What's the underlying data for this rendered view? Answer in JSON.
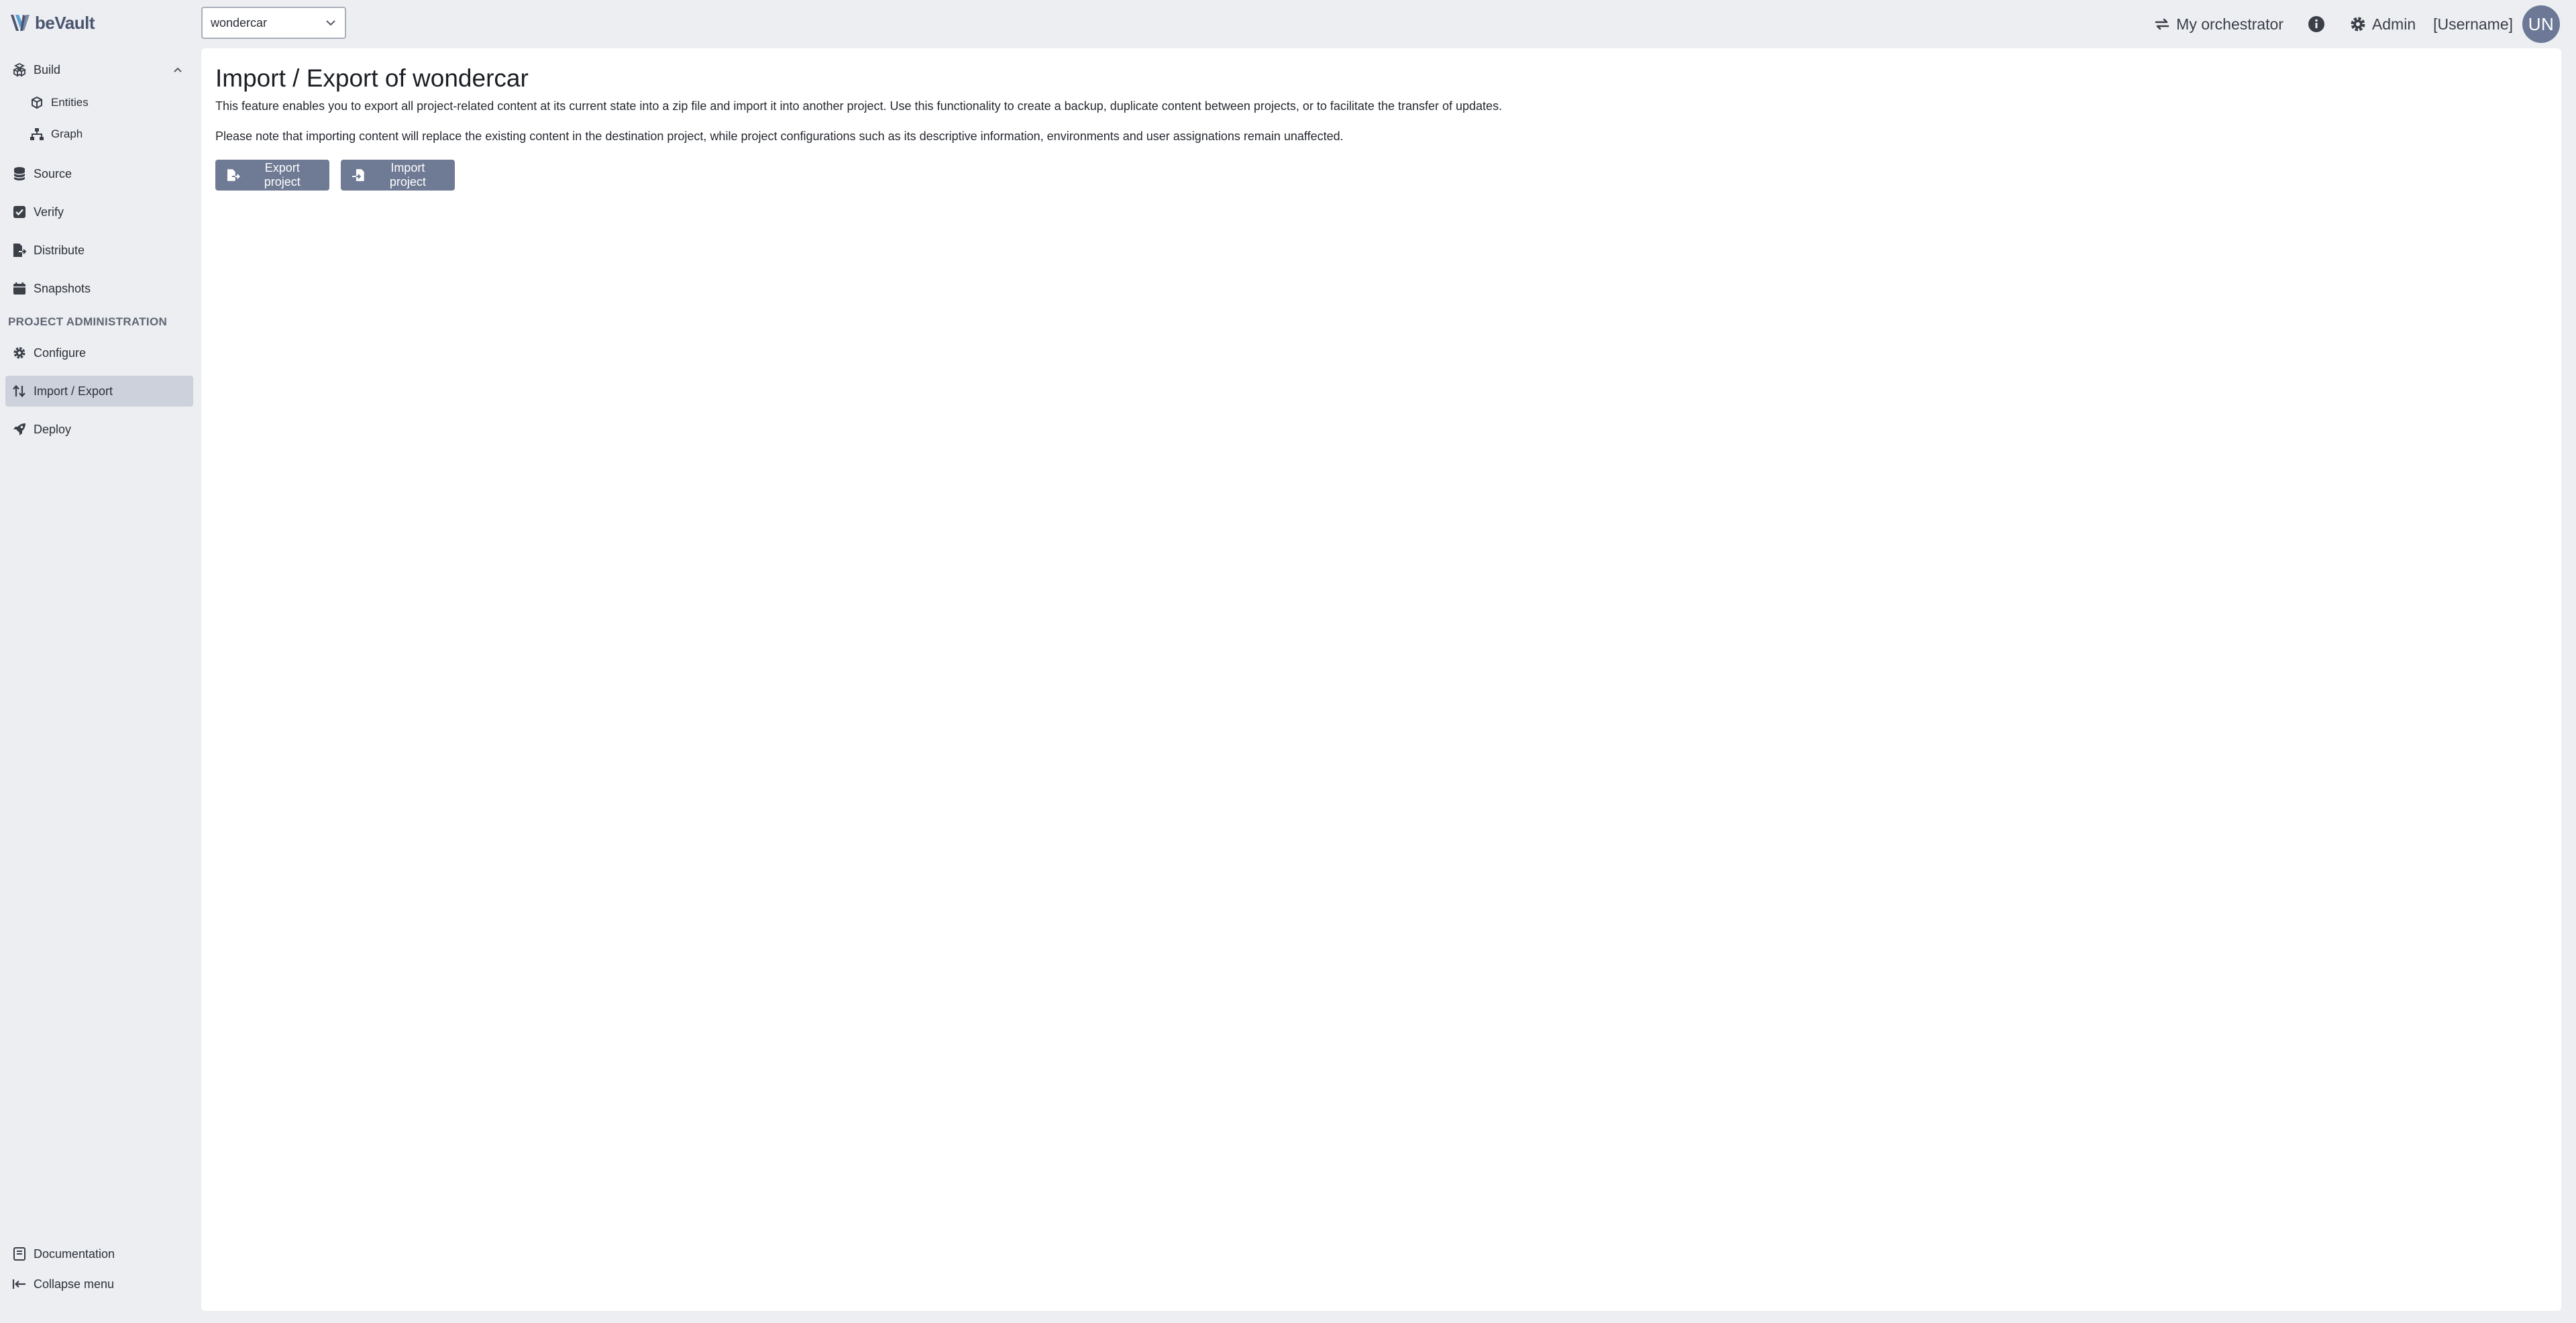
{
  "brand": {
    "name": "beVault",
    "logo_color": "#4a5570",
    "logo_accent": "#5aa0d6"
  },
  "project_selector": {
    "value": "wondercar",
    "icon": "chevron-down-icon"
  },
  "header": {
    "orchestrator_label": "My orchestrator",
    "orchestrator_icon": "sync-arrows-icon",
    "info_icon": "info-circle-icon",
    "admin_label": "Admin",
    "admin_icon": "gear-icon",
    "username": "[Username]",
    "avatar_initials": "UN",
    "avatar_color": "#6d7896"
  },
  "sidebar": {
    "items": [
      {
        "label": "Build",
        "icon": "cubes-icon"
      },
      {
        "label": "Entities",
        "icon": "cube-icon"
      },
      {
        "label": "Graph",
        "icon": "sitemap-icon"
      },
      {
        "label": "Source",
        "icon": "database-icon"
      },
      {
        "label": "Verify",
        "icon": "check-square-icon"
      },
      {
        "label": "Distribute",
        "icon": "file-export-icon"
      },
      {
        "label": "Snapshots",
        "icon": "calendar-icon"
      }
    ],
    "section_label": "PROJECT ADMINISTRATION",
    "admin_items": [
      {
        "label": "Configure",
        "icon": "gear-icon"
      },
      {
        "label": "Import / Export",
        "icon": "sort-arrows-icon",
        "active": true
      },
      {
        "label": "Deploy",
        "icon": "rocket-icon"
      }
    ],
    "footer": {
      "documentation": "Documentation",
      "collapse": "Collapse menu"
    },
    "active_bg": "#cdd1dc"
  },
  "main": {
    "title": "Import / Export of wondercar",
    "description_1": "This feature enables you to export all project-related content at its current state into a zip file and import it into another project. Use this functionality to create a backup, duplicate content between projects, or to facilitate the transfer of updates.",
    "description_2": "Please note that importing content will replace the existing content in the destination project, while project configurations such as its descriptive information, environments and user assignations remain unaffected.",
    "export_button": "Export project",
    "import_button": "Import project",
    "button_color": "#6f7a94"
  }
}
